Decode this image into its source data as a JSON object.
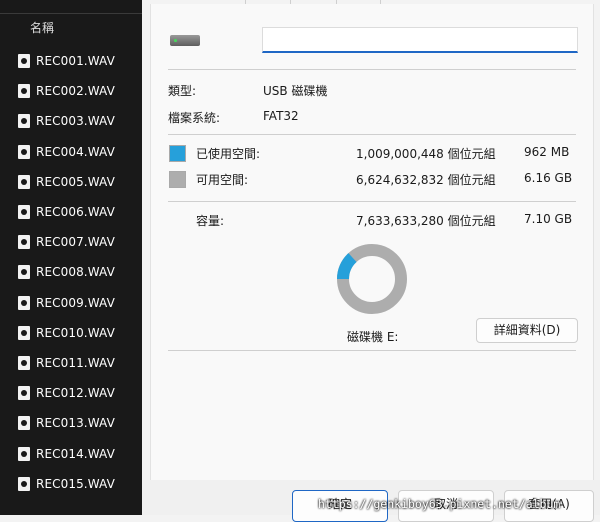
{
  "explorer": {
    "column_header": "名稱",
    "files": [
      "REC001.WAV",
      "REC002.WAV",
      "REC003.WAV",
      "REC004.WAV",
      "REC005.WAV",
      "REC006.WAV",
      "REC007.WAV",
      "REC008.WAV",
      "REC009.WAV",
      "REC010.WAV",
      "REC011.WAV",
      "REC012.WAV",
      "REC013.WAV",
      "REC014.WAV",
      "REC015.WAV"
    ]
  },
  "properties": {
    "name_value": "",
    "type_label": "類型:",
    "type_value": "USB 磁碟機",
    "fs_label": "檔案系統:",
    "fs_value": "FAT32",
    "used_label": "已使用空間:",
    "used_bytes": "1,009,000,448 個位元組",
    "used_size": "962 MB",
    "free_label": "可用空間:",
    "free_bytes": "6,624,632,832 個位元組",
    "free_size": "6.16 GB",
    "capacity_label": "容量:",
    "capacity_bytes": "7,633,633,280 個位元組",
    "capacity_size": "7.10 GB",
    "drive_label": "磁碟機 E:",
    "details_button": "詳細資料(D)",
    "used_fraction": 0.1322,
    "used_color": "#26a0da",
    "free_color": "#adadad"
  },
  "footer": {
    "ok_label": "確定",
    "cancel_label": "取消",
    "apply_label": "套用(A)"
  },
  "watermark": "https://genkiboy63.pixnet.net/album"
}
